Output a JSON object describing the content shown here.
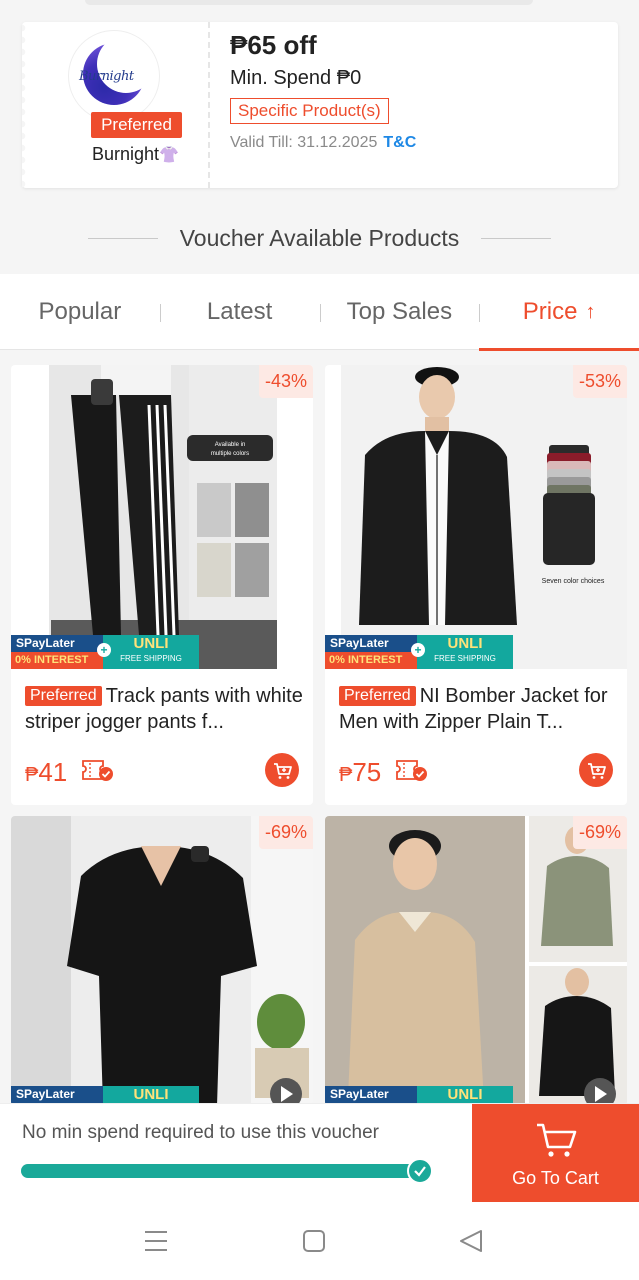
{
  "voucher": {
    "shop_logo_text": "Burnight",
    "preferred_label": "Preferred",
    "shop_name": "Burnight",
    "amount": "₱65 off",
    "min_spend": "Min. Spend ₱0",
    "tag": "Specific Product(s)",
    "valid_till": "Valid Till: 31.12.2025",
    "tc_link": "T&C"
  },
  "section_title": "Voucher Available Products",
  "sort_tabs": [
    {
      "label": "Popular",
      "active": false
    },
    {
      "label": "Latest",
      "active": false
    },
    {
      "label": "Top Sales",
      "active": false
    },
    {
      "label": "Price",
      "active": true,
      "arrow": "↑"
    }
  ],
  "promo_badges": {
    "spaylater": "SPayLater",
    "interest": "0% INTEREST",
    "unli": "UNLI",
    "free_shipping": "FREE SHIPPING"
  },
  "products": [
    {
      "discount": "-43%",
      "preferred": "Preferred",
      "title": "Track pants with white striper jogger pants f...",
      "currency": "₱",
      "price": "41",
      "image_caption": "Available in multiple colors"
    },
    {
      "discount": "-53%",
      "preferred": "Preferred",
      "title": "NI Bomber Jacket for Men with Zipper Plain T...",
      "currency": "₱",
      "price": "75",
      "image_caption": "Seven color choices"
    },
    {
      "discount": "-69%"
    },
    {
      "discount": "-69%"
    }
  ],
  "bottom_bar": {
    "no_min_text": "No min spend required to use this voucher",
    "progress": 1.0,
    "go_to_cart": "Go To Cart"
  },
  "colors": {
    "accent": "#ee4d2d",
    "progress": "#1aa999",
    "link": "#1e88e5"
  }
}
